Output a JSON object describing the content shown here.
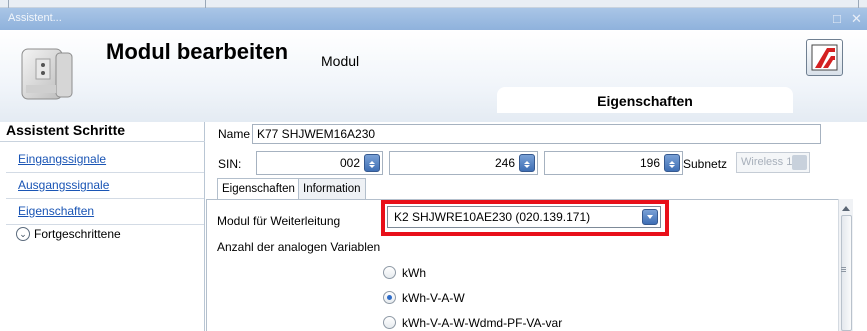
{
  "window": {
    "title": "Assistent..."
  },
  "header": {
    "title": "Modul bearbeiten",
    "subtitle": "Modul",
    "tab_label": "Eigenschaften"
  },
  "sidebar": {
    "title": "Assistent Schritte",
    "items": [
      {
        "label": "Eingangssignale"
      },
      {
        "label": "Ausgangssignale"
      },
      {
        "label": "Eigenschaften"
      }
    ],
    "advanced_label": "Fortgeschrittene"
  },
  "form": {
    "name_label": "Name",
    "name_value": "K77 SHJWEM16A230",
    "sin_label": "SIN:",
    "sin_values": [
      "002",
      "246",
      "196"
    ],
    "subnet_label": "Subnetz",
    "subnet_value": "Wireless 1"
  },
  "tabs": [
    {
      "label": "Eigenschaften",
      "active": true
    },
    {
      "label": "Information",
      "active": false
    }
  ],
  "content": {
    "forward_label": "Modul für Weiterleitung",
    "forward_value": "K2 SHJWRE10AE230 (020.139.171)",
    "analog_label": "Anzahl der analogen Variablen",
    "options": [
      {
        "label": "kWh",
        "selected": false
      },
      {
        "label": "kWh-V-A-W",
        "selected": true
      },
      {
        "label": "kWh-V-A-W-Wdmd-PF-VA-var",
        "selected": false
      }
    ]
  },
  "colors": {
    "highlight": "#e8101a",
    "link": "#1a55b5",
    "titlebar": "#8fb2dc"
  }
}
